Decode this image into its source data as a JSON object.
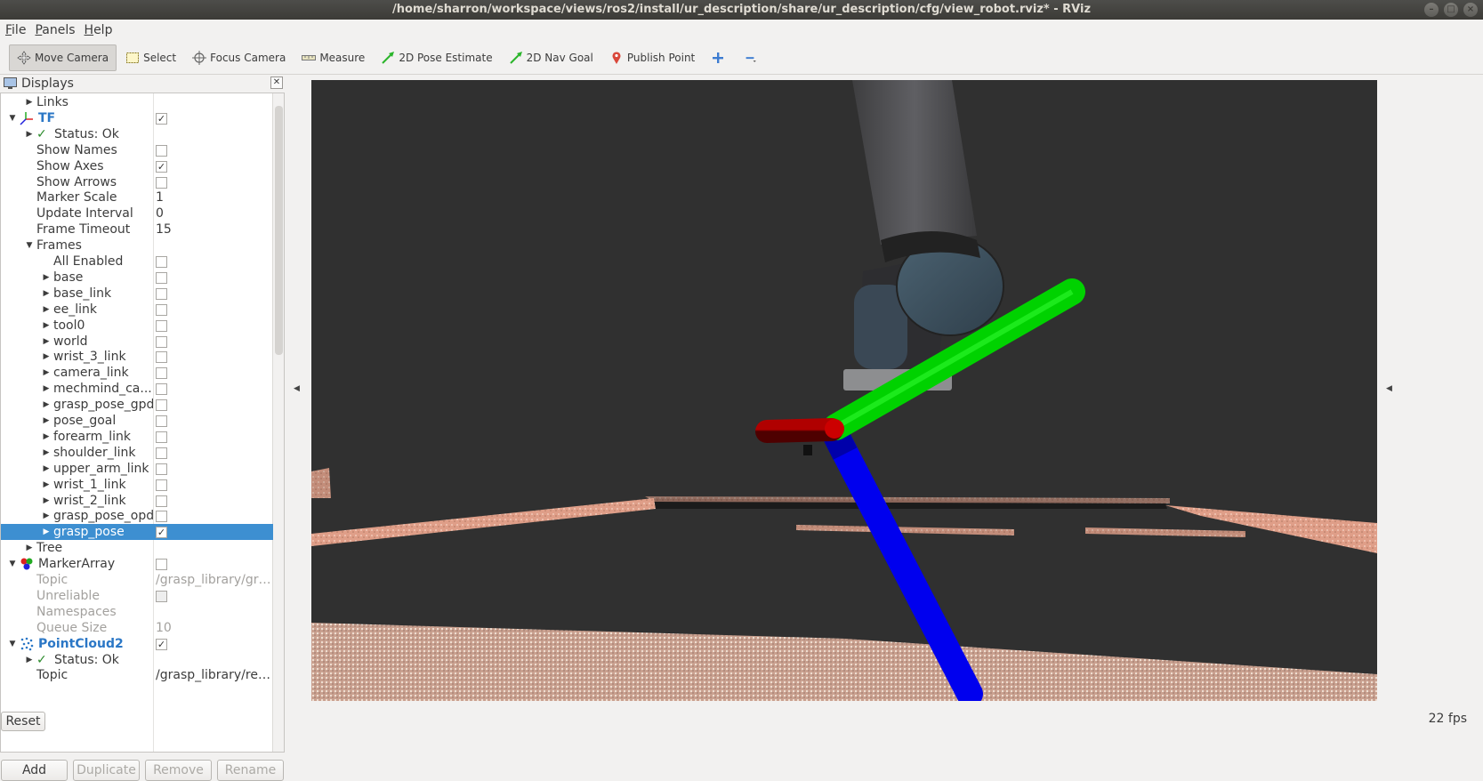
{
  "window": {
    "title": "/home/sharron/workspace/views/ros2/install/ur_description/share/ur_description/cfg/view_robot.rviz* - RViz"
  },
  "menu": [
    {
      "label": "File",
      "u": "F",
      "rest": "ile"
    },
    {
      "label": "Panels",
      "u": "P",
      "rest": "anels"
    },
    {
      "label": "Help",
      "u": "H",
      "rest": "elp"
    }
  ],
  "toolbar": {
    "move_camera": "Move Camera",
    "select": "Select",
    "focus_camera": "Focus Camera",
    "measure": "Measure",
    "pose_estimate": "2D Pose Estimate",
    "nav_goal": "2D Nav Goal",
    "publish_point": "Publish Point"
  },
  "displays": {
    "title": "Displays",
    "rows": [
      {
        "label": "Links"
      },
      {
        "label": "TF"
      },
      {
        "label": "Status: Ok"
      },
      {
        "label": "Show Names"
      },
      {
        "label": "Show Axes"
      },
      {
        "label": "Show Arrows"
      },
      {
        "label": "Marker Scale",
        "value": "1"
      },
      {
        "label": "Update Interval",
        "value": "0"
      },
      {
        "label": "Frame Timeout",
        "value": "15"
      },
      {
        "label": "Frames"
      },
      {
        "label": "All Enabled"
      },
      {
        "label": "base"
      },
      {
        "label": "base_link"
      },
      {
        "label": "ee_link"
      },
      {
        "label": "tool0"
      },
      {
        "label": "world"
      },
      {
        "label": "wrist_3_link"
      },
      {
        "label": "camera_link"
      },
      {
        "label": "mechmind_ca..."
      },
      {
        "label": "grasp_pose_gpd"
      },
      {
        "label": "pose_goal"
      },
      {
        "label": "forearm_link"
      },
      {
        "label": "shoulder_link"
      },
      {
        "label": "upper_arm_link"
      },
      {
        "label": "wrist_1_link"
      },
      {
        "label": "wrist_2_link"
      },
      {
        "label": "grasp_pose_opd"
      },
      {
        "label": "grasp_pose"
      },
      {
        "label": "Tree"
      },
      {
        "label": "MarkerArray"
      },
      {
        "label": "Topic",
        "value": "/grasp_library/gras..."
      },
      {
        "label": "Unreliable"
      },
      {
        "label": "Namespaces"
      },
      {
        "label": "Queue Size",
        "value": "10"
      },
      {
        "label": "PointCloud2"
      },
      {
        "label": "Status: Ok"
      },
      {
        "label": "Topic",
        "value": "/grasp_library/reg..."
      }
    ]
  },
  "buttons": {
    "add": "Add",
    "duplicate": "Duplicate",
    "remove": "Remove",
    "rename": "Rename",
    "reset": "Reset"
  },
  "status": {
    "fps": "22 fps"
  },
  "colors": {
    "selection": "#3d8fd1",
    "x_axis": "#cc0000",
    "y_axis": "#00cc00",
    "z_axis": "#0000ee",
    "viewport_bg": "#303030"
  }
}
